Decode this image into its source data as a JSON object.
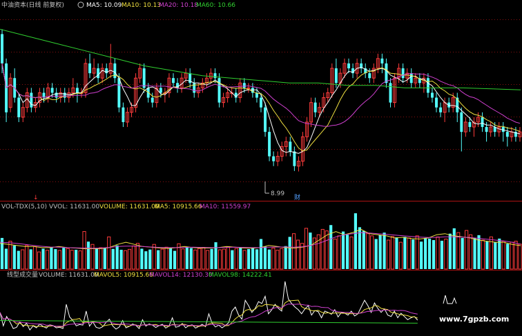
{
  "header": {
    "title": "中油资本(日线 前复权)",
    "ma5": "MA5: 10.09",
    "ma10": "MA10: 10.13",
    "ma20": "MA20: 10.18",
    "ma60": "MA60: 10.66"
  },
  "vol_panel": {
    "name": "VOL-TDX(5,10)",
    "vvol": "VVOL: 11631.00",
    "volume": "VOLUME: 11631.00",
    "ma5": "MA5: 10915.66",
    "ma10": "MA10: 11559.97"
  },
  "line_panel": {
    "name": "线型成交量",
    "volume": "VOLUME: 11631.00",
    "mavol5": "MAVOL5: 10915.66",
    "mavol14": "MAVOL14: 12130.30",
    "mavol98": "MAVOL98: 14222.41"
  },
  "annotations": {
    "low_price": "8.99",
    "cai_marker": "财",
    "watermark": "www.7gpzb.com"
  },
  "colors": {
    "up": "#ff3c3c",
    "down": "#54ffff",
    "ma5": "#ffffff",
    "ma10": "#f0e040",
    "ma20": "#d040d0",
    "ma60": "#30d030",
    "title_text": "#c0c0c0",
    "grid": "#8a1010"
  },
  "chart_data": {
    "type": "candlestick",
    "price_ylim": [
      8.8,
      12.3
    ],
    "low_label": 8.99,
    "candles": [
      [
        11.8,
        11.2,
        11.9,
        11.0
      ],
      [
        11.2,
        10.2,
        11.3,
        10.0
      ],
      [
        10.3,
        10.9,
        11.0,
        10.2
      ],
      [
        10.9,
        10.5,
        11.1,
        10.4
      ],
      [
        10.5,
        10.1,
        10.6,
        10.0
      ],
      [
        10.1,
        10.3,
        10.4,
        10.0
      ],
      [
        10.3,
        10.6,
        10.7,
        10.2
      ],
      [
        10.6,
        10.3,
        10.7,
        10.2
      ],
      [
        10.3,
        10.4,
        10.5,
        10.2
      ],
      [
        10.4,
        10.6,
        10.7,
        10.3
      ],
      [
        10.6,
        10.5,
        10.7,
        10.4
      ],
      [
        10.5,
        10.7,
        10.8,
        10.4
      ],
      [
        10.7,
        10.6,
        10.8,
        10.5
      ],
      [
        10.6,
        10.5,
        10.7,
        10.4
      ],
      [
        10.5,
        10.6,
        10.7,
        10.4
      ],
      [
        10.6,
        10.5,
        10.7,
        10.4
      ],
      [
        10.5,
        10.6,
        10.7,
        10.4
      ],
      [
        10.6,
        10.7,
        10.9,
        10.5
      ],
      [
        10.7,
        10.6,
        10.8,
        10.4
      ],
      [
        10.6,
        10.6,
        10.7,
        10.5
      ],
      [
        10.6,
        11.2,
        11.3,
        10.5
      ],
      [
        11.2,
        11.0,
        11.4,
        10.9
      ],
      [
        11.0,
        11.1,
        11.3,
        10.9
      ],
      [
        11.1,
        10.9,
        11.2,
        10.8
      ],
      [
        10.9,
        11.1,
        11.2,
        10.8
      ],
      [
        11.1,
        11.0,
        11.2,
        10.9
      ],
      [
        11.0,
        11.2,
        11.6,
        10.9
      ],
      [
        11.2,
        10.9,
        11.3,
        10.8
      ],
      [
        10.9,
        10.3,
        11.0,
        10.2
      ],
      [
        10.3,
        10.0,
        10.4,
        9.9
      ],
      [
        10.0,
        10.2,
        10.3,
        9.9
      ],
      [
        10.2,
        10.3,
        10.4,
        10.1
      ],
      [
        10.3,
        10.9,
        11.0,
        10.2
      ],
      [
        10.9,
        11.1,
        11.2,
        10.8
      ],
      [
        11.1,
        10.7,
        11.2,
        10.6
      ],
      [
        10.7,
        10.5,
        10.8,
        10.4
      ],
      [
        10.5,
        10.4,
        10.6,
        10.3
      ],
      [
        10.4,
        10.7,
        10.8,
        10.3
      ],
      [
        10.7,
        10.6,
        10.8,
        10.5
      ],
      [
        10.6,
        10.6,
        10.7,
        10.4
      ],
      [
        10.6,
        10.9,
        11.0,
        10.5
      ],
      [
        10.9,
        10.8,
        11.0,
        10.7
      ],
      [
        10.8,
        10.7,
        10.9,
        10.6
      ],
      [
        10.7,
        10.9,
        11.0,
        10.6
      ],
      [
        10.9,
        11.0,
        11.1,
        10.8
      ],
      [
        11.0,
        10.8,
        11.1,
        10.7
      ],
      [
        10.8,
        10.6,
        10.9,
        10.5
      ],
      [
        10.6,
        10.7,
        10.8,
        10.5
      ],
      [
        10.7,
        10.8,
        10.9,
        10.6
      ],
      [
        10.8,
        10.9,
        11.0,
        10.7
      ],
      [
        10.9,
        11.0,
        11.1,
        10.8
      ],
      [
        11.0,
        10.9,
        11.1,
        10.8
      ],
      [
        10.9,
        10.4,
        11.0,
        10.3
      ],
      [
        10.4,
        10.5,
        10.6,
        10.3
      ],
      [
        10.5,
        10.6,
        10.7,
        10.4
      ],
      [
        10.6,
        10.6,
        10.7,
        10.5
      ],
      [
        10.6,
        10.5,
        10.7,
        10.4
      ],
      [
        10.5,
        10.8,
        10.9,
        10.4
      ],
      [
        10.8,
        10.7,
        10.9,
        10.6
      ],
      [
        10.7,
        10.7,
        10.8,
        10.6
      ],
      [
        10.7,
        10.6,
        10.8,
        10.5
      ],
      [
        10.6,
        10.5,
        10.7,
        10.4
      ],
      [
        10.5,
        10.3,
        10.6,
        10.2
      ],
      [
        10.3,
        9.8,
        10.4,
        9.7
      ],
      [
        9.8,
        9.3,
        9.9,
        9.2
      ],
      [
        9.3,
        9.2,
        9.4,
        9.1
      ],
      [
        9.2,
        9.3,
        9.4,
        9.1
      ],
      [
        9.3,
        9.5,
        9.6,
        9.2
      ],
      [
        9.5,
        9.6,
        9.7,
        9.3
      ],
      [
        9.6,
        9.4,
        9.7,
        9.3
      ],
      [
        9.4,
        9.1,
        9.5,
        9.0
      ],
      [
        9.1,
        9.2,
        9.3,
        8.99
      ],
      [
        9.2,
        9.7,
        9.8,
        9.1
      ],
      [
        9.7,
        10.0,
        10.1,
        9.6
      ],
      [
        10.0,
        10.4,
        10.5,
        9.9
      ],
      [
        10.4,
        10.2,
        10.5,
        10.1
      ],
      [
        10.2,
        10.3,
        10.4,
        10.1
      ],
      [
        10.3,
        10.5,
        10.6,
        10.2
      ],
      [
        10.5,
        10.6,
        10.7,
        10.4
      ],
      [
        10.6,
        11.1,
        11.2,
        10.5
      ],
      [
        11.1,
        10.8,
        11.3,
        10.7
      ],
      [
        10.8,
        11.0,
        11.1,
        10.7
      ],
      [
        11.0,
        11.2,
        11.3,
        10.9
      ],
      [
        11.2,
        11.1,
        11.3,
        11.0
      ],
      [
        11.1,
        11.0,
        11.2,
        10.9
      ],
      [
        11.0,
        11.2,
        11.3,
        10.9
      ],
      [
        11.2,
        11.1,
        11.3,
        11.0
      ],
      [
        11.1,
        11.0,
        11.2,
        10.9
      ],
      [
        11.0,
        10.9,
        11.1,
        10.8
      ],
      [
        10.9,
        11.1,
        11.2,
        10.8
      ],
      [
        11.1,
        11.3,
        11.4,
        11.0
      ],
      [
        11.3,
        11.2,
        11.4,
        11.0
      ],
      [
        11.2,
        10.8,
        11.3,
        10.7
      ],
      [
        10.8,
        10.4,
        10.9,
        10.3
      ],
      [
        10.4,
        10.9,
        11.0,
        10.3
      ],
      [
        10.9,
        11.1,
        11.2,
        10.8
      ],
      [
        11.1,
        10.9,
        11.2,
        10.8
      ],
      [
        10.9,
        11.0,
        11.1,
        10.8
      ],
      [
        11.0,
        10.8,
        11.1,
        10.7
      ],
      [
        10.8,
        10.9,
        11.0,
        10.7
      ],
      [
        10.9,
        10.8,
        11.0,
        10.7
      ],
      [
        10.8,
        10.9,
        11.0,
        10.6
      ],
      [
        10.9,
        10.6,
        11.0,
        10.5
      ],
      [
        10.6,
        10.5,
        10.7,
        10.4
      ],
      [
        10.5,
        10.3,
        10.6,
        10.2
      ],
      [
        10.3,
        10.2,
        10.4,
        10.1
      ],
      [
        10.2,
        10.4,
        10.5,
        10.0
      ],
      [
        10.4,
        10.3,
        10.5,
        10.2
      ],
      [
        10.3,
        10.5,
        10.6,
        10.2
      ],
      [
        10.5,
        10.2,
        10.6,
        10.0
      ],
      [
        10.2,
        9.8,
        10.3,
        9.4
      ],
      [
        9.8,
        10.0,
        10.1,
        9.7
      ],
      [
        10.0,
        9.9,
        10.1,
        9.8
      ],
      [
        9.9,
        10.0,
        10.1,
        9.7
      ],
      [
        10.0,
        10.1,
        10.2,
        9.9
      ],
      [
        10.1,
        9.9,
        10.2,
        9.8
      ],
      [
        9.9,
        9.8,
        10.0,
        9.6
      ],
      [
        9.8,
        9.9,
        10.0,
        9.7
      ],
      [
        9.9,
        9.8,
        10.0,
        9.7
      ],
      [
        9.8,
        9.9,
        10.0,
        9.7
      ],
      [
        9.9,
        9.8,
        10.0,
        9.6
      ],
      [
        9.8,
        9.7,
        9.9,
        9.5
      ],
      [
        9.7,
        9.8,
        9.9,
        9.6
      ],
      [
        9.8,
        9.7,
        9.9,
        9.6
      ],
      [
        9.7,
        9.8,
        9.9,
        9.6
      ]
    ],
    "ma60": [
      11.9,
      11.75,
      11.6,
      11.45,
      11.3,
      11.15,
      11.05,
      10.95,
      10.9,
      10.85,
      10.8,
      10.8,
      10.75,
      10.75,
      10.7,
      10.7,
      10.7,
      10.68,
      10.66
    ],
    "volume": [
      14500,
      9500,
      13000,
      11000,
      8500,
      9000,
      11000,
      9200,
      10500,
      8000,
      9500,
      8800,
      10200,
      9300,
      8700,
      9900,
      9600,
      8800,
      9000,
      8500,
      17500,
      12800,
      11500,
      9500,
      10000,
      9800,
      15000,
      9400,
      11000,
      9000,
      8600,
      9200,
      10800,
      12000,
      9500,
      8300,
      9100,
      11500,
      8800,
      9300,
      10200,
      9700,
      8500,
      11800,
      9400,
      10200,
      9800,
      8900,
      9600,
      10100,
      8700,
      9400,
      12500,
      9000,
      9300,
      10400,
      8800,
      9600,
      9900,
      8700,
      9300,
      10100,
      9200,
      14000,
      10500,
      9100,
      9800,
      8800,
      9600,
      10700,
      15000,
      16500,
      13500,
      12000,
      19000,
      17000,
      14500,
      16000,
      18500,
      17800,
      20500,
      14000,
      15500,
      17500,
      16000,
      15000,
      26000,
      19500,
      17800,
      16500,
      15500,
      14000,
      15800,
      17000,
      13500,
      15200,
      14800,
      12500,
      15000,
      14500,
      13800,
      15500,
      12800,
      14500,
      14200,
      13500,
      15000,
      13200,
      14000,
      16500,
      19000,
      17000,
      14500,
      18000,
      16000,
      14500,
      15800,
      13500,
      13000,
      15000,
      12500,
      14200,
      13000,
      11800,
      12500,
      13000,
      11631
    ],
    "vol_ma5": [
      12000,
      11500,
      11000,
      10500,
      10500,
      10000,
      10000,
      10500,
      10000,
      9800,
      9500,
      9500,
      9500,
      10000,
      11500,
      12500,
      11500,
      10500,
      10200,
      9800,
      9600,
      10000,
      10500,
      10000,
      9800,
      9800,
      10000,
      10500,
      10200,
      9800,
      9700,
      10000,
      11000,
      10500,
      10000,
      9800,
      10200,
      11000,
      13500,
      16000,
      17500,
      16000,
      17000,
      18500,
      16500,
      16000,
      15500,
      14500,
      14800,
      14200,
      14000,
      14500,
      16000,
      16500,
      15500,
      15000,
      14500,
      13500,
      13000,
      12500,
      12500,
      11500,
      10916
    ],
    "vol_ma10": [
      12500,
      12300,
      12000,
      11500,
      11000,
      10600,
      10300,
      10200,
      10000,
      9900,
      9800,
      9700,
      9800,
      10100,
      10500,
      10700,
      10700,
      10500,
      10300,
      10100,
      10000,
      10000,
      10100,
      10200,
      10100,
      10000,
      10000,
      10100,
      10200,
      10100,
      10000,
      10000,
      10200,
      10300,
      10300,
      10200,
      10400,
      11000,
      12000,
      13500,
      15000,
      16000,
      16500,
      17000,
      16800,
      16500,
      16200,
      15800,
      15500,
      15200,
      14900,
      14700,
      14800,
      15000,
      15000,
      14900,
      14700,
      14300,
      13900,
      13500,
      13100,
      12500,
      11560
    ],
    "mavol5": 10915.66,
    "mavol14": 12130.3,
    "mavol98": 14222.41
  }
}
